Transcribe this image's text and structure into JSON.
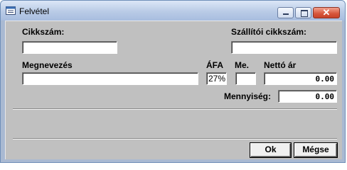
{
  "window": {
    "title": "Felvétel",
    "icon": "form-window-icon",
    "controls": {
      "minimize": "minimize-icon",
      "maximize": "maximize-icon",
      "close": "close-icon"
    }
  },
  "form": {
    "cikkszam": {
      "label": "Cikkszám:",
      "value": ""
    },
    "szallitoi_cikkszam": {
      "label": "Szállítói cikkszám:",
      "value": ""
    },
    "megnevezes": {
      "label": "Megnevezés",
      "value": ""
    },
    "afa": {
      "label": "ÁFA",
      "value": "27%"
    },
    "me": {
      "label": "Me.",
      "value": ""
    },
    "netto_ar": {
      "label": "Nettó ár",
      "value": "0.00"
    },
    "mennyiseg": {
      "label": "Mennyiség:",
      "value": "0.00"
    }
  },
  "buttons": {
    "ok": "Ok",
    "cancel": "Mégse"
  }
}
